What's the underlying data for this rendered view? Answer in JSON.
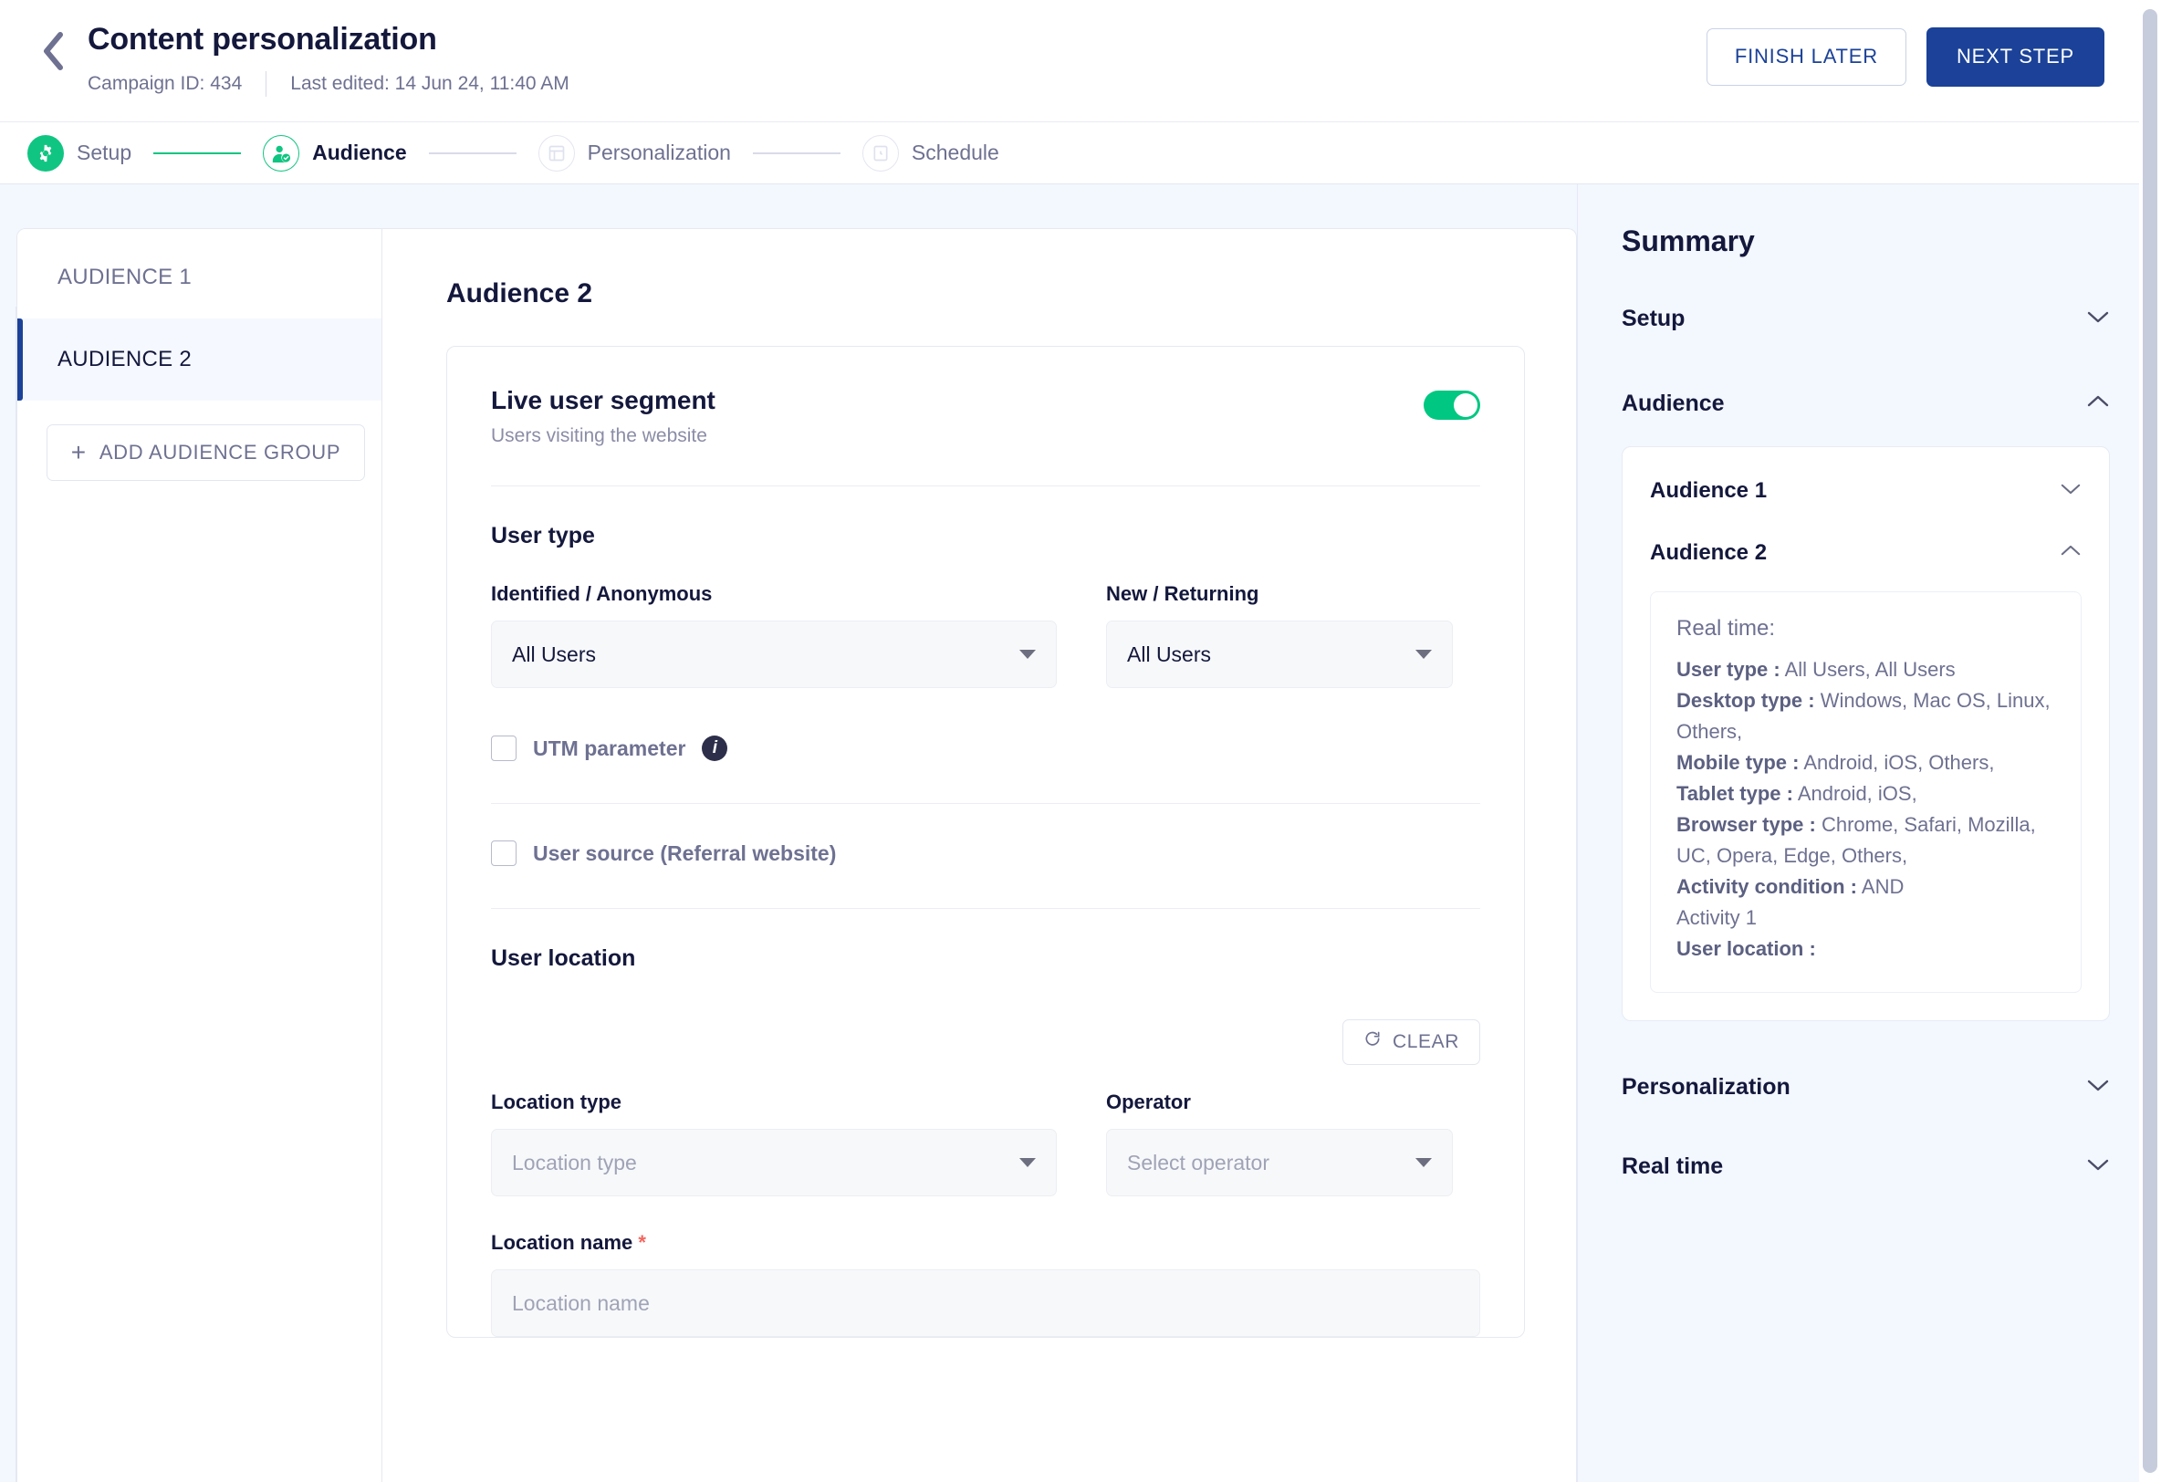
{
  "header": {
    "back_icon": "chevron-left-icon",
    "title": "Content personalization",
    "campaign_id_label": "Campaign ID: 434",
    "last_edited_label": "Last edited: 14 Jun 24, 11:40 AM",
    "finish_later_label": "FINISH LATER",
    "next_step_label": "NEXT STEP"
  },
  "stepper": {
    "steps": [
      {
        "label": "Setup",
        "state": "done",
        "icon": "gear-icon"
      },
      {
        "label": "Audience",
        "state": "active",
        "icon": "user-check-icon"
      },
      {
        "label": "Personalization",
        "state": "todo",
        "icon": "layout-icon"
      },
      {
        "label": "Schedule",
        "state": "todo",
        "icon": "clock-icon"
      }
    ]
  },
  "audience_list": {
    "items": [
      {
        "label": "AUDIENCE 1",
        "selected": false
      },
      {
        "label": "AUDIENCE 2",
        "selected": true
      }
    ],
    "add_label": "ADD AUDIENCE GROUP",
    "add_icon": "plus-icon"
  },
  "form": {
    "heading": "Audience 2",
    "card": {
      "title": "Live user segment",
      "subtitle": "Users visiting the website",
      "toggle_on": true
    },
    "user_type": {
      "section_title": "User type",
      "identified_label": "Identified / Anonymous",
      "identified_value": "All Users",
      "new_returning_label": "New / Returning",
      "new_returning_value": "All Users",
      "utm_label": "UTM parameter",
      "utm_checked": false,
      "utm_info_icon": "info-icon",
      "user_source_label": "User source (Referral website)",
      "user_source_checked": false
    },
    "user_location": {
      "section_title": "User location",
      "clear_label": "CLEAR",
      "clear_icon": "refresh-icon",
      "location_type_label": "Location type",
      "location_type_placeholder": "Location type",
      "operator_label": "Operator",
      "operator_placeholder": "Select operator",
      "location_name_label": "Location name",
      "location_name_required": "*",
      "location_name_placeholder": "Location name"
    }
  },
  "summary": {
    "title": "Summary",
    "sections": [
      {
        "label": "Setup",
        "expanded": false
      },
      {
        "label": "Audience",
        "expanded": true
      },
      {
        "label": "Personalization",
        "expanded": false
      },
      {
        "label": "Real time",
        "expanded": false
      }
    ],
    "audiences": [
      {
        "label": "Audience 1",
        "expanded": false
      },
      {
        "label": "Audience 2",
        "expanded": true
      }
    ],
    "detail": {
      "heading": "Real time:",
      "lines": [
        {
          "key": "User type :",
          "value": " All Users, All Users"
        },
        {
          "key": "Desktop type :",
          "value": " Windows, Mac OS, Linux, Others,"
        },
        {
          "key": "Mobile type :",
          "value": " Android, iOS, Others,"
        },
        {
          "key": "Tablet type :",
          "value": " Android, iOS,"
        },
        {
          "key": "Browser type :",
          "value": " Chrome, Safari, Mozilla, UC, Opera, Edge, Others,"
        },
        {
          "key": "Activity condition :",
          "value": " AND"
        },
        {
          "key": "",
          "value": "Activity 1"
        },
        {
          "key": "User location :",
          "value": ""
        }
      ]
    }
  },
  "colors": {
    "primary": "#1b4298",
    "accent_green": "#10c582",
    "toggle_on": "#00c781",
    "text_dark": "#14183c",
    "text_muted": "#6e7191",
    "required_red": "#f2665e",
    "panel_bg": "#f3f7fe"
  }
}
